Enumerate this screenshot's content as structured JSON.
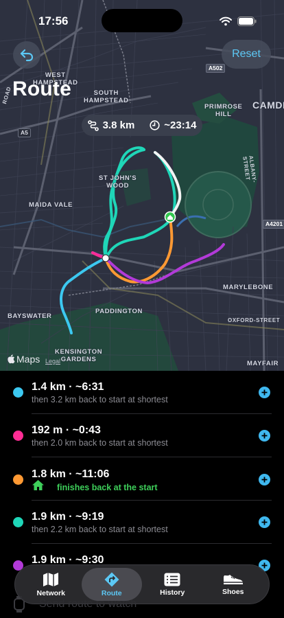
{
  "status_bar": {
    "time": "17:56"
  },
  "header": {
    "title": "Route",
    "reset_label": "Reset"
  },
  "summary": {
    "distance": "3.8 km",
    "duration": "~23:14"
  },
  "map": {
    "labels": {
      "west_hampstead": "WEST\nHAMPSTEAD",
      "south_hampstead": "SOUTH\nHAMPSTEAD",
      "primrose_hill": "PRIMROSE\nHILL",
      "camden": "CAMDE",
      "st_johns_wood": "ST JOHN'S\nWOOD",
      "maida_vale": "MAIDA VALE",
      "marylebone": "MARYLEBONE",
      "bayswater": "BAYSWATER",
      "paddington": "PADDINGTON",
      "kensington_gardens": "KENSINGTON\nGARDENS",
      "mayfair": "MAYFAIR",
      "oxford_street": "OXFORD-STREET",
      "albany_street": "ALBANY-STREET",
      "finchley_road": "ROAD"
    },
    "shields": {
      "a502": "A502",
      "a5": "A5",
      "a4201": "A4201"
    },
    "logo": "Maps",
    "legal": "Legal"
  },
  "routes": [
    {
      "color": "#3cc8f0",
      "title": "1.4 km · ~6:31",
      "subtitle": "then 3.2 km back to start at shortest",
      "finishes_home": false
    },
    {
      "color": "#ff2d95",
      "title": "192 m · ~0:43",
      "subtitle": "then 2.0 km back to start at shortest",
      "finishes_home": false
    },
    {
      "color": "#ff9933",
      "title": "1.8 km · ~11:06",
      "subtitle": "finishes back at the start",
      "finishes_home": true
    },
    {
      "color": "#1fd6b8",
      "title": "1.9 km · ~9:19",
      "subtitle": "then 2.2 km back to start at shortest",
      "finishes_home": false
    },
    {
      "color": "#b23ad8",
      "title": "1.9 km · ~9:30",
      "subtitle": "",
      "finishes_home": false
    }
  ],
  "watch": {
    "label": "Send route to watch"
  },
  "tabs": [
    {
      "label": "Network",
      "icon": "map-icon",
      "active": false
    },
    {
      "label": "Route",
      "icon": "turn-arrow-icon",
      "active": true
    },
    {
      "label": "History",
      "icon": "list-icon",
      "active": false
    },
    {
      "label": "Shoes",
      "icon": "shoe-icon",
      "active": false
    }
  ],
  "colors": {
    "accent": "#5cc8f5",
    "add_button": "#3fb8ef",
    "home_green": "#3ecf5a"
  }
}
